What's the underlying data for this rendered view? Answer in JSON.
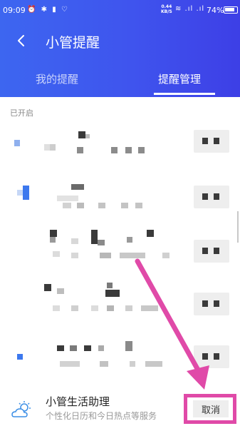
{
  "status_bar": {
    "time": "09:09",
    "left_icons": "⏰ ✱ ▮ ♡",
    "speed_value": "0.44",
    "speed_unit": "KB/S",
    "right_icons": "≋ .ıl .ıl",
    "battery": "74%"
  },
  "header": {
    "title": "小管提醒",
    "back_icon": "chevron-left-icon",
    "background": "#3f54ee"
  },
  "tabs": [
    {
      "label": "我的提醒",
      "active": false
    },
    {
      "label": "提醒管理",
      "active": true
    }
  ],
  "section": {
    "label": "已开启"
  },
  "list_items": [
    {
      "state": "enabled",
      "content": "obscured"
    },
    {
      "state": "enabled",
      "content": "obscured"
    },
    {
      "state": "enabled",
      "content": "obscured"
    },
    {
      "state": "enabled",
      "content": "obscured"
    },
    {
      "state": "enabled",
      "content": "obscured"
    }
  ],
  "assistant": {
    "title": "小管生活助理",
    "description": "个性化日历和今日热点等服务",
    "icon": "weather-cloud-sun-icon",
    "cancel_label": "取消"
  },
  "annotation": {
    "arrow_color": "#e04aa8",
    "highlight_color": "#e04aa8"
  }
}
